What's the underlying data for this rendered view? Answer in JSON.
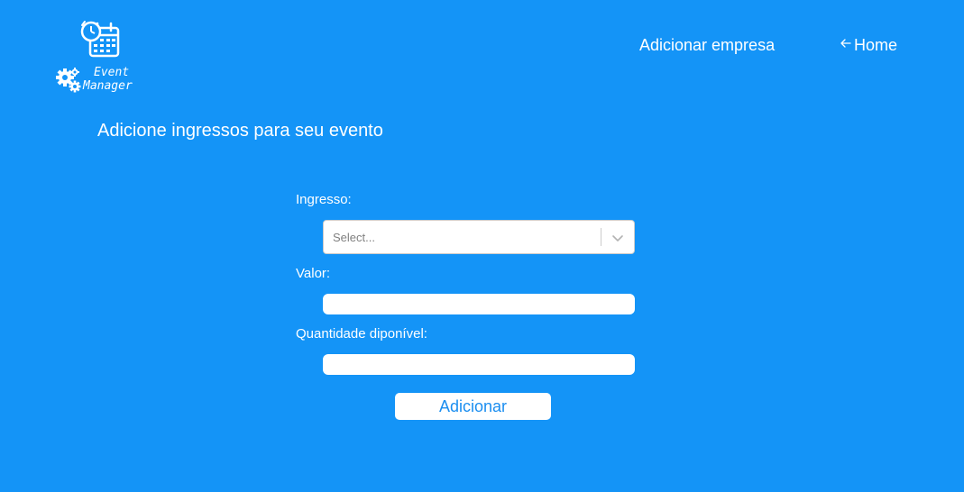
{
  "logo": {
    "line1": "Event",
    "line2": "Manager"
  },
  "nav": {
    "empresa_label": "Adicionar empresa",
    "home_label": "Home"
  },
  "page": {
    "title": "Adicione ingressos para seu evento"
  },
  "form": {
    "ingresso_label": "Ingresso:",
    "ingresso_placeholder": "Select...",
    "valor_label": "Valor:",
    "valor_value": "",
    "quantidade_label": "Quantidade diponível:",
    "quantidade_value": "",
    "submit_label": "Adicionar"
  },
  "colors": {
    "background": "#1494f7",
    "button_text": "#1b8ef0"
  },
  "icons": {
    "logo_calendar": "calendar-clock-icon",
    "logo_gears": "gears-icon",
    "home_arrow": "arrow-left-icon",
    "select_chevron": "chevron-down-icon"
  }
}
